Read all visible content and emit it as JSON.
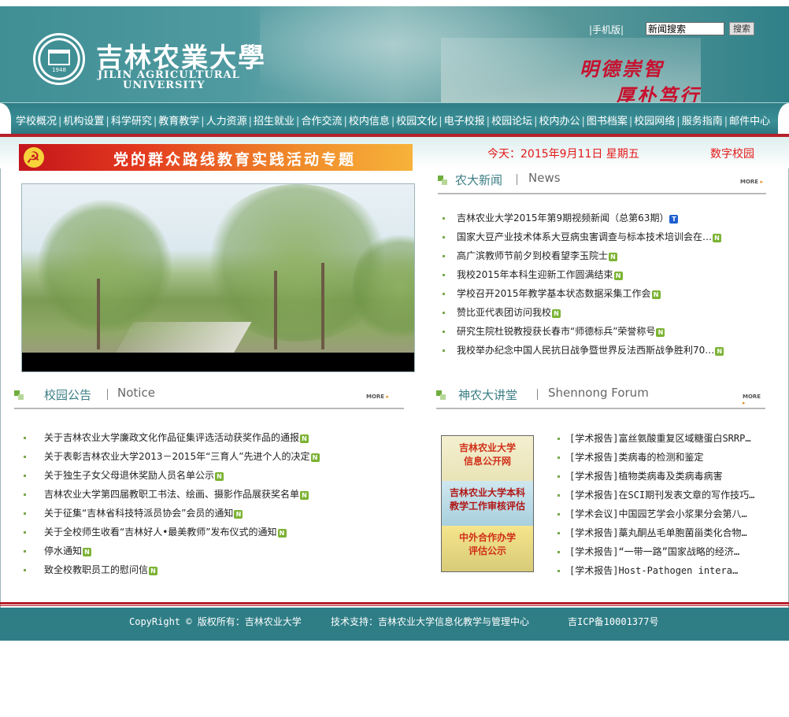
{
  "header": {
    "logo_cn": "吉林农業大學",
    "logo_en_line1": "JILIN AGRICULTURAL",
    "logo_en_line2": "UNIVERSITY",
    "seal_year": "1948",
    "motto_line1": "明德崇智",
    "motto_line2": "厚朴笃行",
    "mobile_link": "|手机版|",
    "search_value": "新闻搜索",
    "search_button": "搜索"
  },
  "nav": {
    "items": [
      "学校概况",
      "机构设置",
      "科学研究",
      "教育教学",
      "人力资源",
      "招生就业",
      "合作交流",
      "校内信息",
      "校园文化",
      "电子校报",
      "校园论坛",
      "校内办公",
      "图书档案",
      "校园网络",
      "服务指南",
      "邮件中心"
    ],
    "separator": "|"
  },
  "banner": {
    "text": "党的群众路线教育实践活动专题"
  },
  "date_text": "今天：2015年9月11日  星期五",
  "digital_campus": "数字校园",
  "news": {
    "title_cn": "农大新闻",
    "title_en": "News",
    "more": "MORE",
    "items": [
      {
        "text": "吉林农业大学2015年第9期视频新闻（总第63期）",
        "badge": "T"
      },
      {
        "text": "国家大豆产业技术体系大豆病虫害调查与标本技术培训会在…",
        "badge": "N"
      },
      {
        "text": "高广滨教师节前夕到校看望李玉院士",
        "badge": "N"
      },
      {
        "text": "我校2015年本科生迎新工作圆满结束",
        "badge": "N"
      },
      {
        "text": "学校召开2015年教学基本状态数据采集工作会",
        "badge": "N"
      },
      {
        "text": "赞比亚代表团访问我校",
        "badge": "N"
      },
      {
        "text": "研究生院杜锐教授获长春市“师德标兵”荣誉称号",
        "badge": "N"
      },
      {
        "text": "我校举办纪念中国人民抗日战争暨世界反法西斯战争胜利70…",
        "badge": "N"
      }
    ]
  },
  "notice": {
    "title_cn": "校园公告",
    "title_en": "Notice",
    "more": "MORE",
    "items": [
      {
        "text": "关于吉林农业大学廉政文化作品征集评选活动获奖作品的通报",
        "badge": "N"
      },
      {
        "text": "关于表彰吉林农业大学2013－2015年“三育人”先进个人的决定",
        "badge": "N"
      },
      {
        "text": "关于独生子女父母退休奖励人员名单公示",
        "badge": "N"
      },
      {
        "text": "吉林农业大学第四届教职工书法、绘画、摄影作品展获奖名单",
        "badge": "N"
      },
      {
        "text": "关于征集“吉林省科技特派员协会”会员的通知",
        "badge": "N"
      },
      {
        "text": "关于全校师生收看“吉林好人•最美教师”发布仪式的通知",
        "badge": "N"
      },
      {
        "text": "停水通知",
        "badge": "N"
      },
      {
        "text": "致全校教职员工的慰问信",
        "badge": "N"
      }
    ]
  },
  "forum": {
    "title_cn": "神农大讲堂",
    "title_en": "Shennong Forum",
    "more": "MORE",
    "items": [
      "[学术报告]富丝氨酸重复区域糖蛋白SRRP…",
      "[学术报告]类病毒的检测和鉴定",
      "[学术报告]植物类病毒及类病毒病害",
      "[学术报告]在SCI期刊发表文章的写作技巧…",
      "[学术会议]中国园艺学会小浆果分会第八…",
      "[学术报告]藁丸酮丛毛单胞菌甾类化合物…",
      "[学术报告]“一带一路”国家战略的经济…",
      "[学术报告]Host-Pathogen intera…"
    ]
  },
  "promos": [
    {
      "line1": "吉林农业大学",
      "line2": "信息公开网"
    },
    {
      "line1": "吉林农业大学本科",
      "line2": "教学工作审核评估"
    },
    {
      "line1": "中外合作办学",
      "line2": "评估公示"
    }
  ],
  "footer": {
    "copyright": "CopyRight © 版权所有：吉林农业大学",
    "tech": "技术支持：吉林农业大学信息化教学与管理中心",
    "icp": "吉ICP备10001377号"
  },
  "colors": {
    "teal": "#2f7e86",
    "accent_red": "#e21818",
    "badge_green": "#7cb334",
    "badge_blue": "#1e5fd0"
  }
}
